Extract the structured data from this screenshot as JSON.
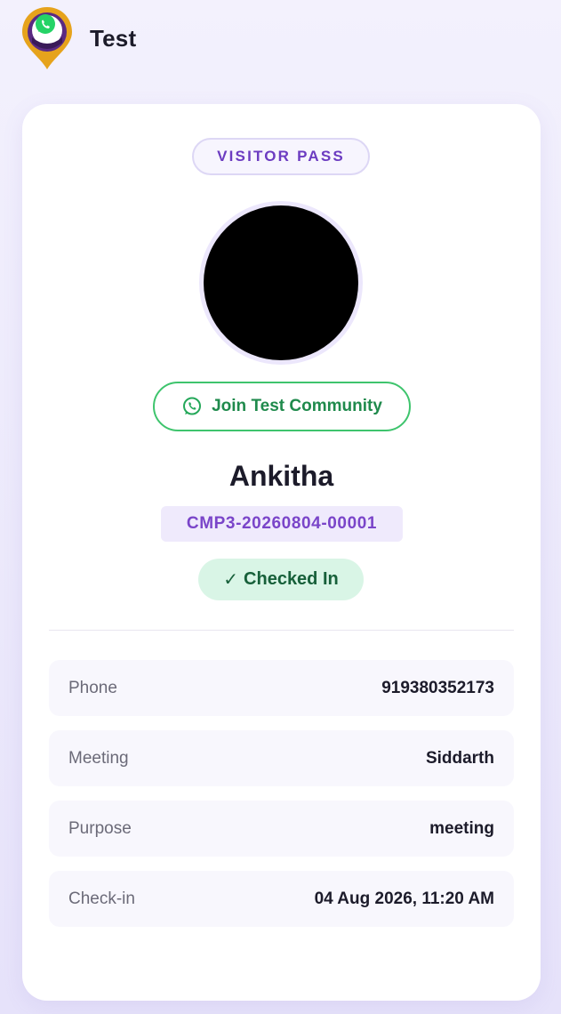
{
  "app": {
    "title": "Test"
  },
  "pass": {
    "badge_label": "VISITOR PASS",
    "join_button_label": "Join Test Community",
    "visitor_name": "Ankitha",
    "visitor_id": "CMP3-20260804-00001",
    "status_label": "Checked In",
    "status_icon": "check-icon"
  },
  "details": [
    {
      "label": "Phone",
      "value": "919380352173"
    },
    {
      "label": "Meeting",
      "value": "Siddarth"
    },
    {
      "label": "Purpose",
      "value": "meeting"
    },
    {
      "label": "Check-in",
      "value": "04 Aug 2026, 11:20 AM"
    }
  ],
  "colors": {
    "accent_purple": "#6c3cc1",
    "whatsapp_green": "#25d366",
    "status_green_bg": "#d9f5e6",
    "status_green_text": "#17603a",
    "logo_gold": "#e6a31c",
    "logo_purple": "#5a2a82"
  }
}
